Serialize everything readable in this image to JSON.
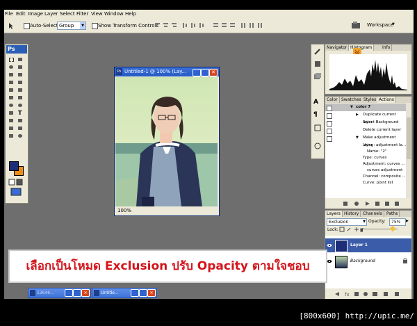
{
  "menu": [
    "File",
    "Edit",
    "Image",
    "Layer",
    "Select",
    "Filter",
    "View",
    "Window",
    "Help"
  ],
  "options": {
    "auto_select_label": "Auto-Select:",
    "group_value": "Group",
    "show_transform_label": "Show Transform Controls",
    "workspace_label": "Workspace"
  },
  "toolbox": {
    "logo": "Ps"
  },
  "document": {
    "title": "Untitled-1 @ 100% (Lay...",
    "zoom": "100%"
  },
  "navigator": {
    "tabs": [
      "Navigator",
      "Histogram",
      "Info"
    ]
  },
  "actions": {
    "tabs": [
      "Color",
      "Swatches",
      "Styles",
      "Actions"
    ],
    "items": [
      "color 7",
      "Duplicate current layer",
      "Select Background",
      "Delete current layer",
      "Make adjustment layer",
      "Using: adjustment la...",
      "Name: \"2\"",
      "Type: curves",
      "Adjustment: curves ...",
      "curves adjustment",
      "Channel: composite ...",
      "Curve: point list"
    ]
  },
  "layers": {
    "tabs": [
      "Layers",
      "History",
      "Channels",
      "Paths"
    ],
    "blend_mode": "Exclusion",
    "opacity_label": "Opacity:",
    "opacity_value": "75%",
    "lock_label": "Lock:",
    "items": [
      {
        "name": "Layer 1"
      },
      {
        "name": "Background"
      }
    ]
  },
  "banner": {
    "text": "เลือกเป็นโหมด Exclusion ปรับ Opacity ตามใจชอบ"
  },
  "minimized": [
    {
      "title": "12646..."
    },
    {
      "title": "Untitle..."
    }
  ],
  "footer": {
    "text": "[800x600] http://upic.me/"
  }
}
